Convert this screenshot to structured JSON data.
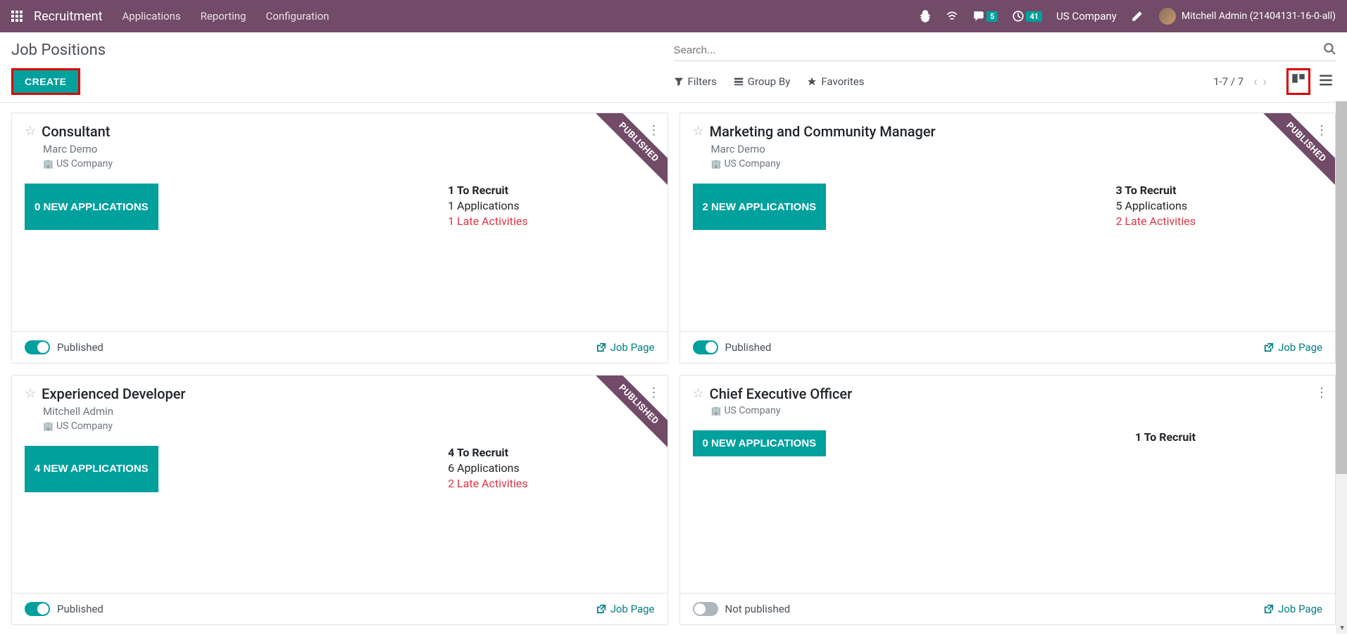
{
  "navbar": {
    "brand": "Recruitment",
    "menu": [
      "Applications",
      "Reporting",
      "Configuration"
    ],
    "chat_badge": "5",
    "clock_badge": "41",
    "company": "US Company",
    "user": "Mitchell Admin (21404131-16-0-all)"
  },
  "control": {
    "title": "Job Positions",
    "create": "CREATE",
    "search_placeholder": "Search...",
    "filters": "Filters",
    "groupby": "Group By",
    "favorites": "Favorites",
    "pager": "1-7 / 7"
  },
  "cards": [
    {
      "title": "Consultant",
      "manager": "Marc Demo",
      "company": "US Company",
      "new_apps": "0 NEW APPLICATIONS",
      "recruit": "1 To Recruit",
      "applications": "1 Applications",
      "late": "1 Late Activities",
      "published_ribbon": "PUBLISHED",
      "published": true,
      "publish_label": "Published",
      "job_page": "Job Page"
    },
    {
      "title": "Marketing and Community Manager",
      "manager": "Marc Demo",
      "company": "US Company",
      "new_apps": "2 NEW APPLICATIONS",
      "recruit": "3 To Recruit",
      "applications": "5 Applications",
      "late": "2 Late Activities",
      "published_ribbon": "PUBLISHED",
      "published": true,
      "publish_label": "Published",
      "job_page": "Job Page"
    },
    {
      "title": "Experienced Developer",
      "manager": "Mitchell Admin",
      "company": "US Company",
      "new_apps": "4 NEW APPLICATIONS",
      "recruit": "4 To Recruit",
      "applications": "6 Applications",
      "late": "2 Late Activities",
      "published_ribbon": "PUBLISHED",
      "published": true,
      "publish_label": "Published",
      "job_page": "Job Page"
    },
    {
      "title": "Chief Executive Officer",
      "manager": "",
      "company": "US Company",
      "new_apps": "0 NEW APPLICATIONS",
      "recruit": "1 To Recruit",
      "applications": "",
      "late": "",
      "published_ribbon": "",
      "published": false,
      "publish_label": "Not published",
      "job_page": "Job Page"
    }
  ]
}
